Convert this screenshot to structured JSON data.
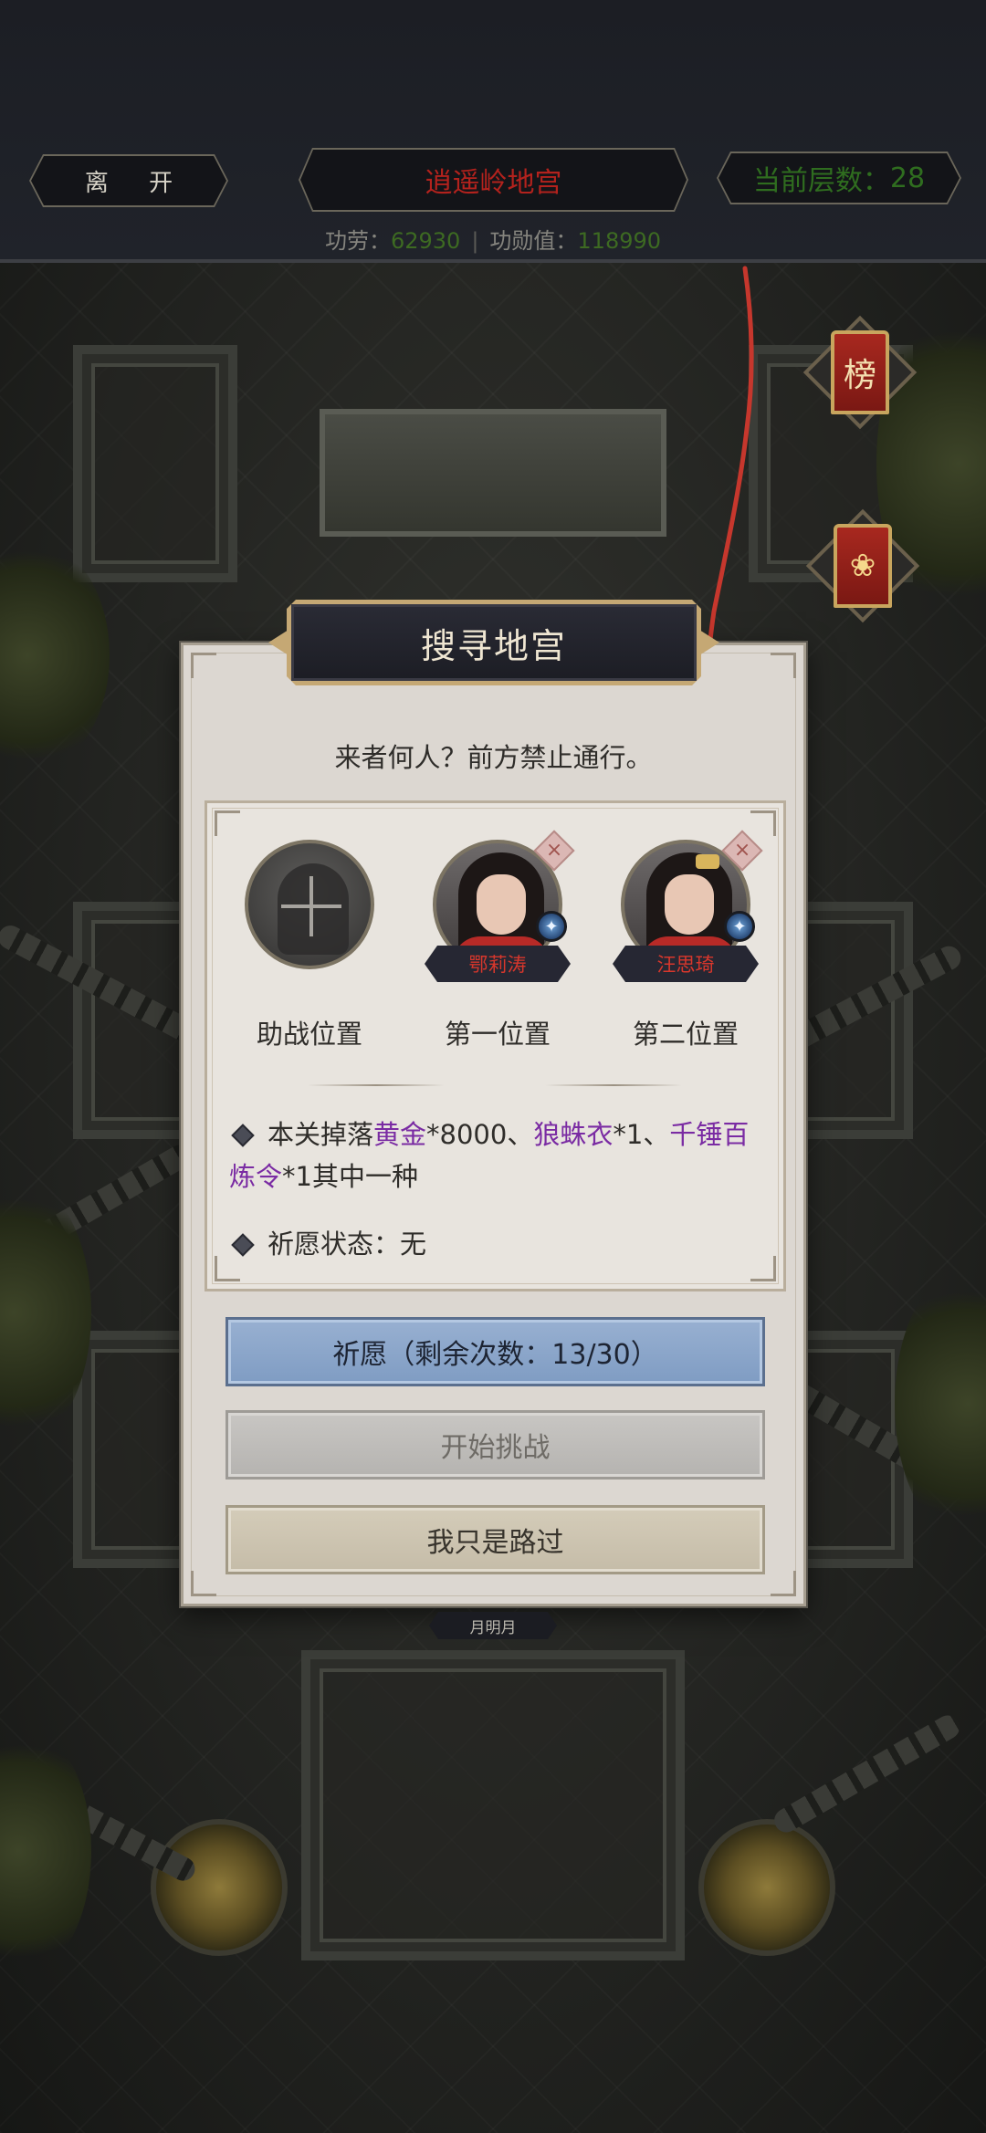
{
  "topbar": {
    "leave_label": "离 开",
    "title": "逍遥岭地宫",
    "floor_label": "当前层数：",
    "floor_value": "28",
    "merit_label": "功劳：",
    "merit_value": "62930",
    "honor_label": "功勋值：",
    "honor_value": "118990",
    "separator": "|"
  },
  "side_icons": {
    "ranking_glyph": "榜",
    "lotus_glyph": "❀"
  },
  "dialog": {
    "title": "搜寻地宫",
    "message": "来者何人？前方禁止通行。",
    "slots": [
      {
        "label": "助战位置",
        "name": "",
        "empty": true
      },
      {
        "label": "第一位置",
        "name": "鄂莉涛",
        "empty": false
      },
      {
        "label": "第二位置",
        "name": "汪思琦",
        "empty": false
      }
    ],
    "remove_glyph": "×",
    "drops": {
      "prefix": "本关掉落",
      "item1": "黄金",
      "item1_qty": "*8000",
      "sep1": "、",
      "item2": "狼蛛衣",
      "item2_qty": "*1",
      "sep2": "、",
      "item3": "千锤百炼令",
      "item3_qty": "*1",
      "suffix": "其中一种"
    },
    "wish_status_label": "祈愿状态：",
    "wish_status_value": "无",
    "buttons": {
      "wish": "祈愿（剩余次数：13/30）",
      "challenge": "开始挑战",
      "pass": "我只是路过"
    }
  },
  "under_tag": "月明月",
  "colors": {
    "title_red": "#b3221d",
    "floor_green": "#2f6d1f",
    "item_purple": "#7a2ba3",
    "wish_button": "#8fa8cc"
  }
}
